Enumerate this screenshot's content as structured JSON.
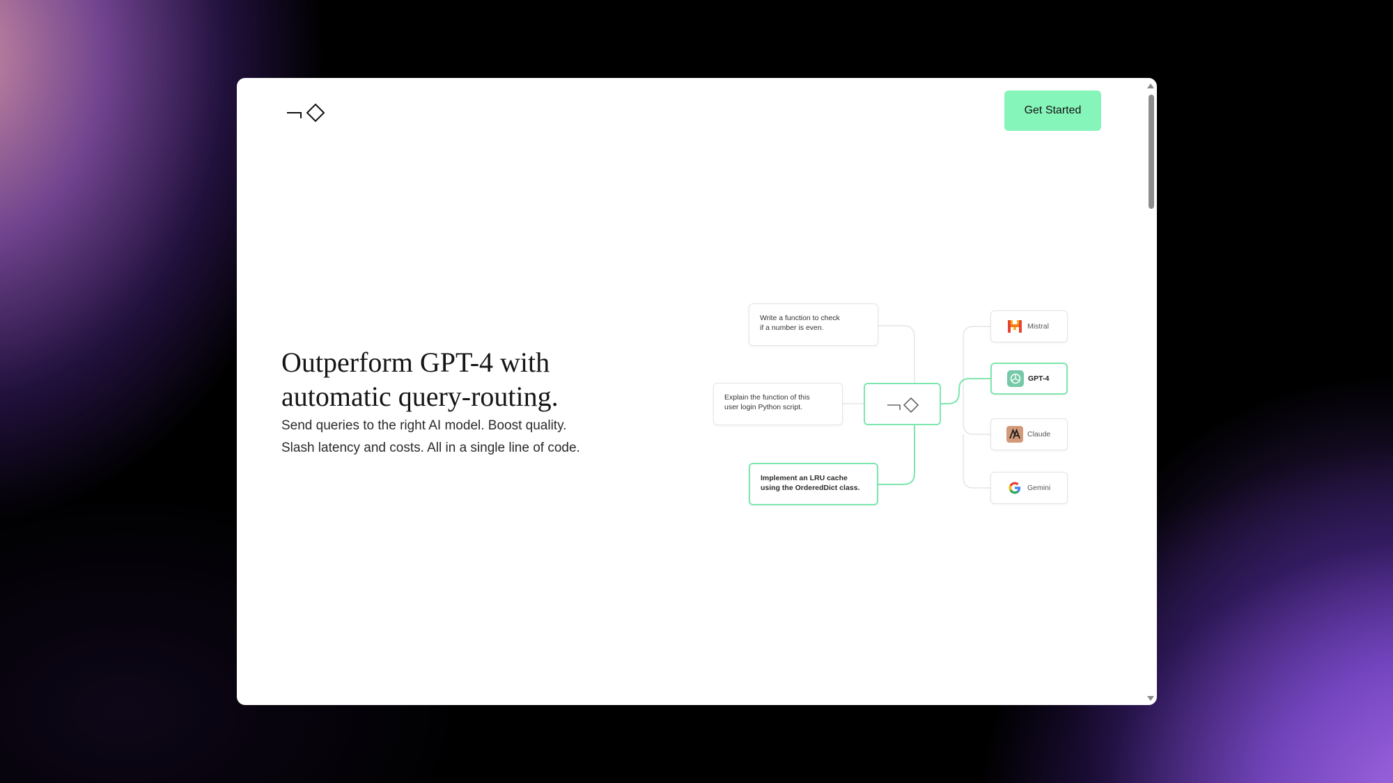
{
  "header": {
    "cta_label": "Get Started",
    "logo_icon": "brand-logo-icon"
  },
  "hero": {
    "headline_line1": "Outperform GPT-4 with",
    "headline_line2": "automatic query-routing.",
    "subhead_line1": "Send queries to the right AI model. Boost quality.",
    "subhead_line2": "Slash latency and costs. All in a single line of code."
  },
  "diagram": {
    "queries": [
      {
        "line1": "Write a function to check",
        "line2": "if a number is even."
      },
      {
        "line1": "Explain the function of this",
        "line2": "user login Python script."
      },
      {
        "line1": "Implement an LRU cache",
        "line2": "using the OrderedDict class."
      }
    ],
    "models": [
      {
        "name": "Mistral",
        "icon": "mistral-icon"
      },
      {
        "name": "GPT-4",
        "icon": "openai-icon"
      },
      {
        "name": "Claude",
        "icon": "anthropic-icon"
      },
      {
        "name": "Gemini",
        "icon": "google-icon"
      }
    ]
  },
  "colors": {
    "accent": "#86f5b9",
    "connector_active": "#7de6ad",
    "connector_inactive": "#e3e5e7"
  }
}
